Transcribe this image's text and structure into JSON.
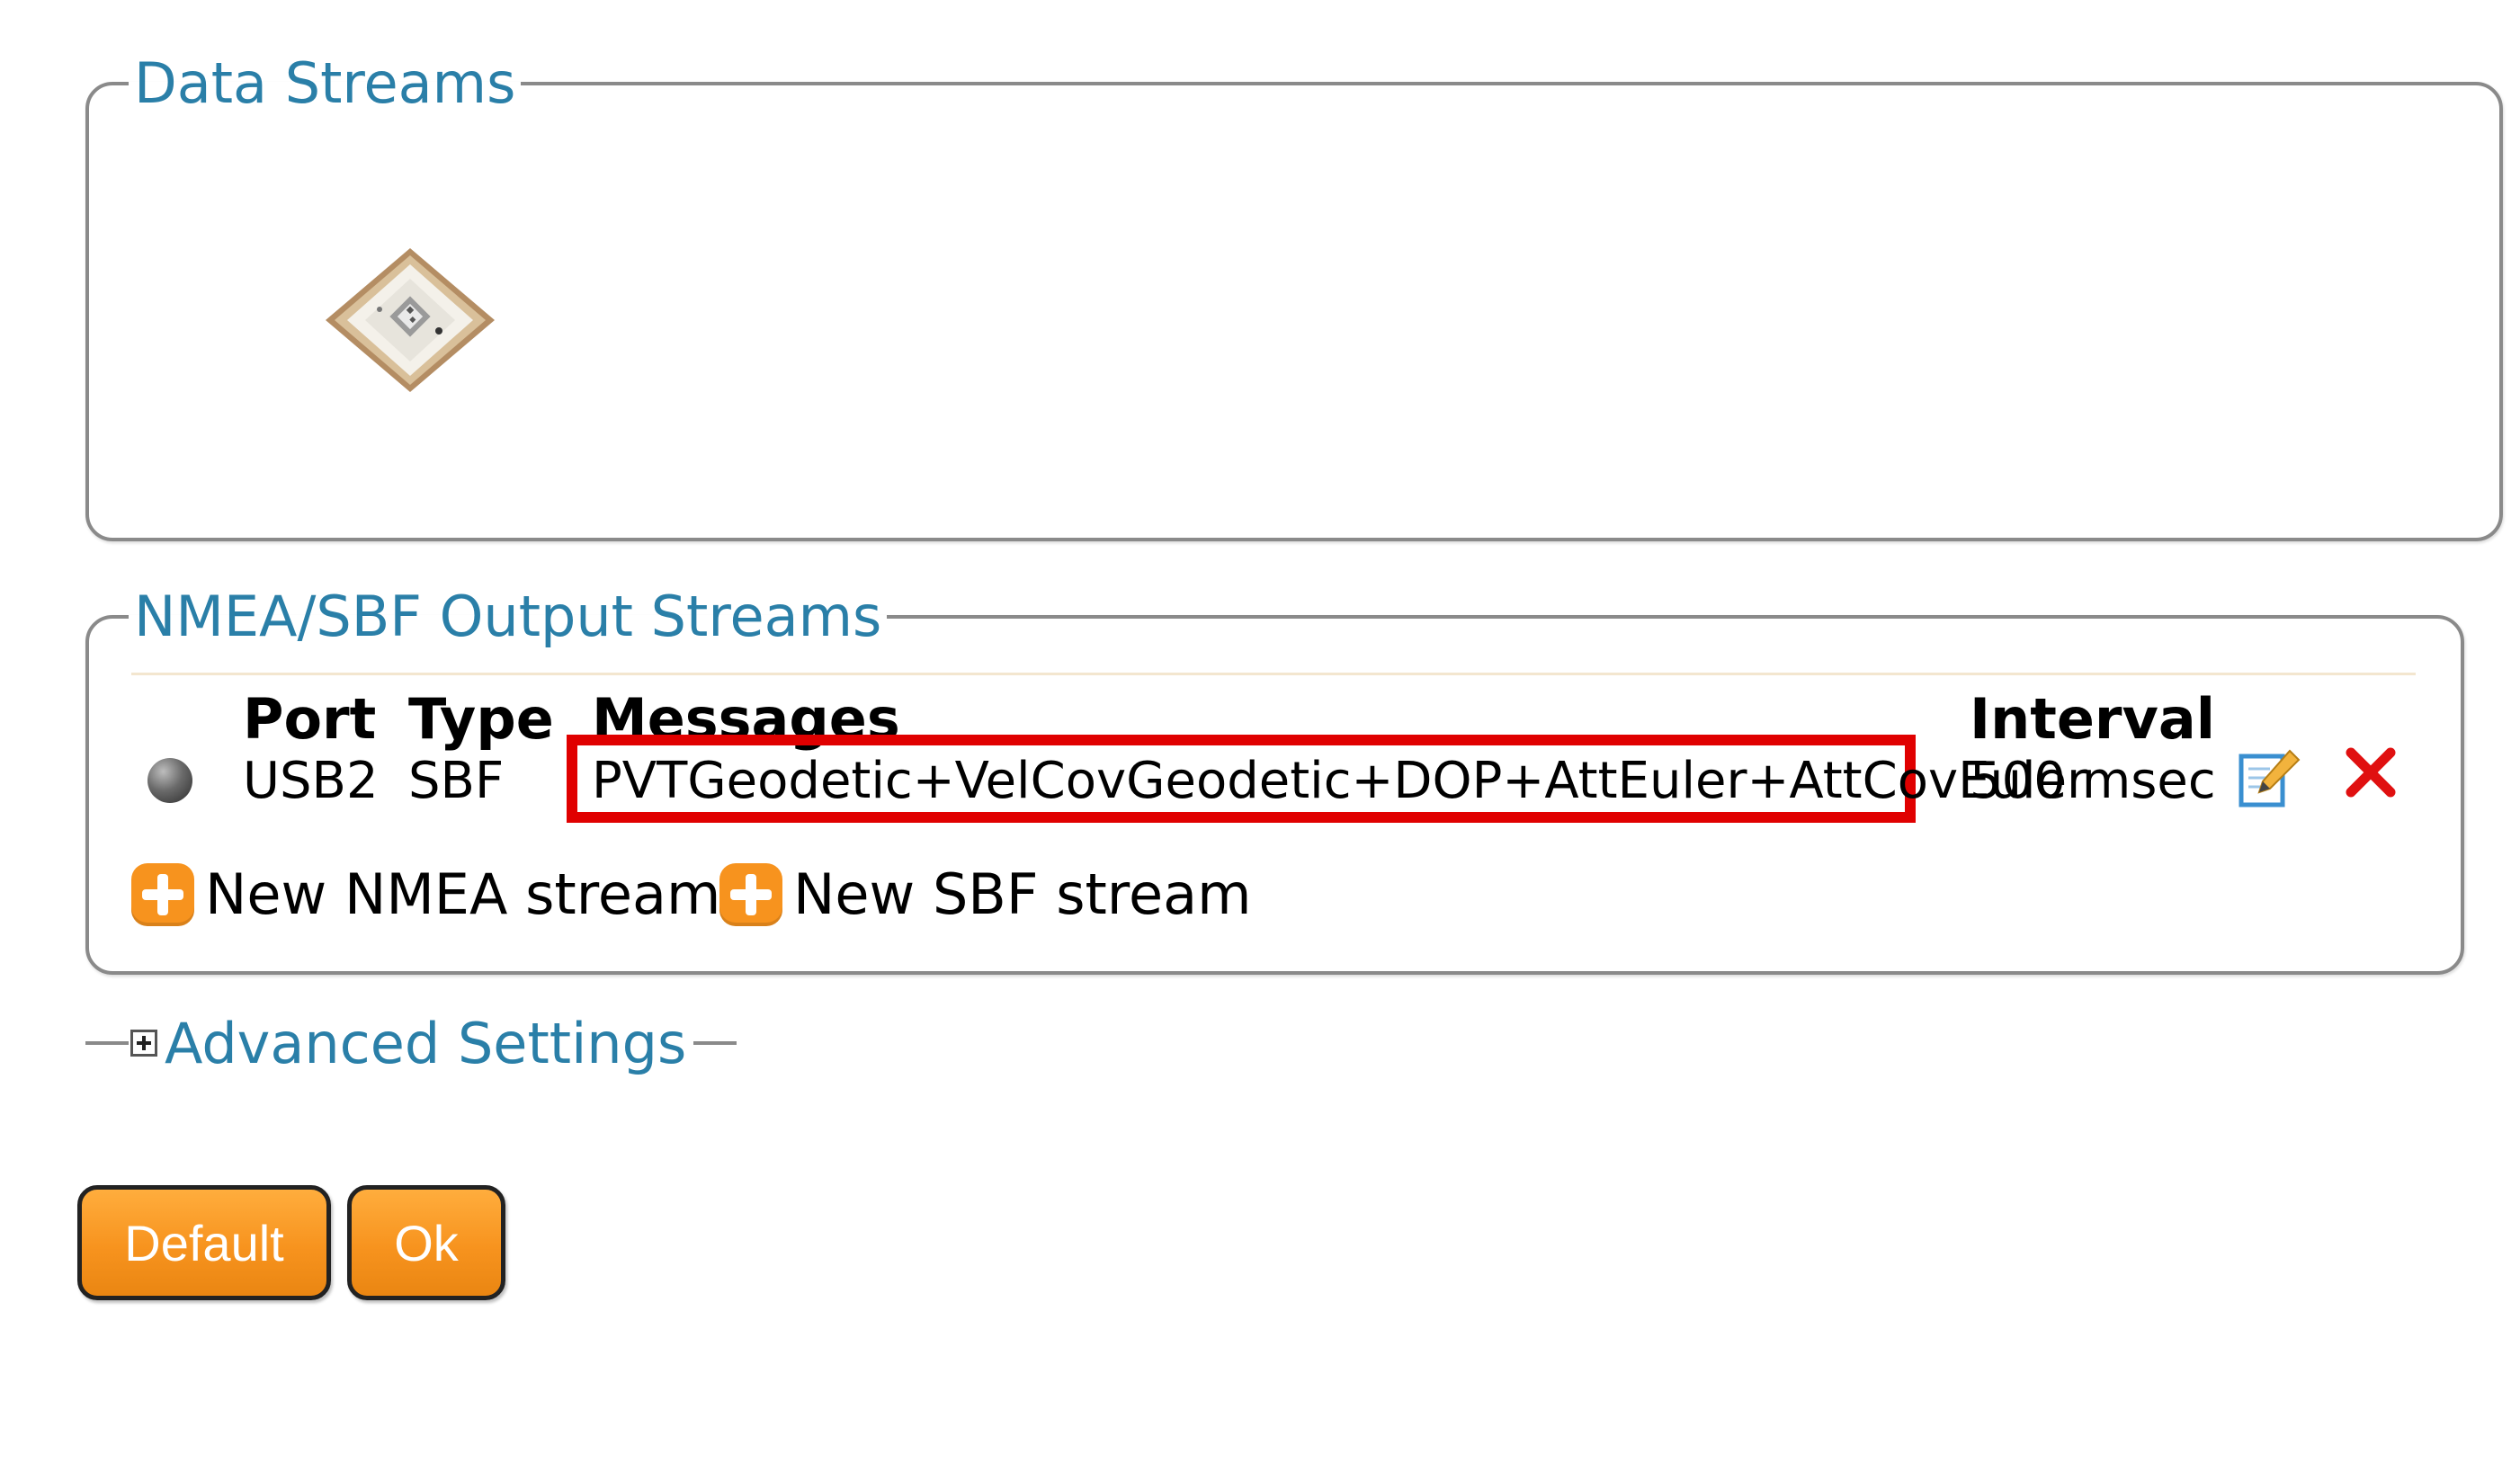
{
  "data_streams": {
    "legend": "Data Streams",
    "device_icon": "gnss-receiver-chip-icon"
  },
  "output_streams": {
    "legend": "NMEA/SBF Output Streams",
    "columns": {
      "port": "Port",
      "type": "Type",
      "messages": "Messages",
      "interval": "Interval"
    },
    "rows": [
      {
        "status_icon": "status-dot-icon",
        "port": "USB2",
        "type": "SBF",
        "messages": "PVTGeodetic+VelCovGeodetic+DOP+AttEuler+AttCovEuler",
        "interval": "500 msec",
        "edit_icon": "edit-icon",
        "delete_icon": "delete-icon"
      }
    ],
    "new_nmea_label": "New NMEA stream",
    "new_sbf_label": "New SBF stream"
  },
  "advanced": {
    "label": "Advanced Settings",
    "expanded": false
  },
  "buttons": {
    "default_label": "Default",
    "ok_label": "Ok"
  },
  "colors": {
    "legend_text": "#2a7fa8",
    "accent_orange": "#f7931e",
    "highlight_red": "#e00000"
  }
}
